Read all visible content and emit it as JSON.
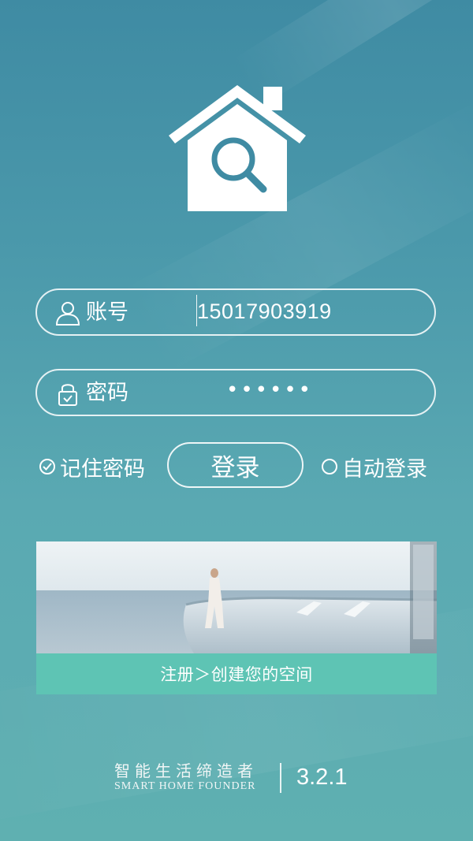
{
  "login_form": {
    "account_label": "账号",
    "account_value": "15017903919",
    "password_label": "密码",
    "password_masked": "••••••"
  },
  "options": {
    "remember_password": "记住密码",
    "login_button": "登录",
    "auto_login": "自动登录"
  },
  "banner": {
    "caption": "注册＞创建您的空间"
  },
  "footer": {
    "slogan_cn": "智能生活缔造者",
    "slogan_en": "SMART HOME FOUNDER",
    "version": "3.2.1"
  },
  "icons": {
    "logo": "house-search-icon",
    "account": "user-icon",
    "password": "lock-icon",
    "remember": "check-circle-icon",
    "auto": "radio-circle-icon"
  },
  "colors": {
    "caption_bar": "#5ec4b4",
    "logo_fill": "#ffffff",
    "logo_accent": "#3f8ba3"
  }
}
